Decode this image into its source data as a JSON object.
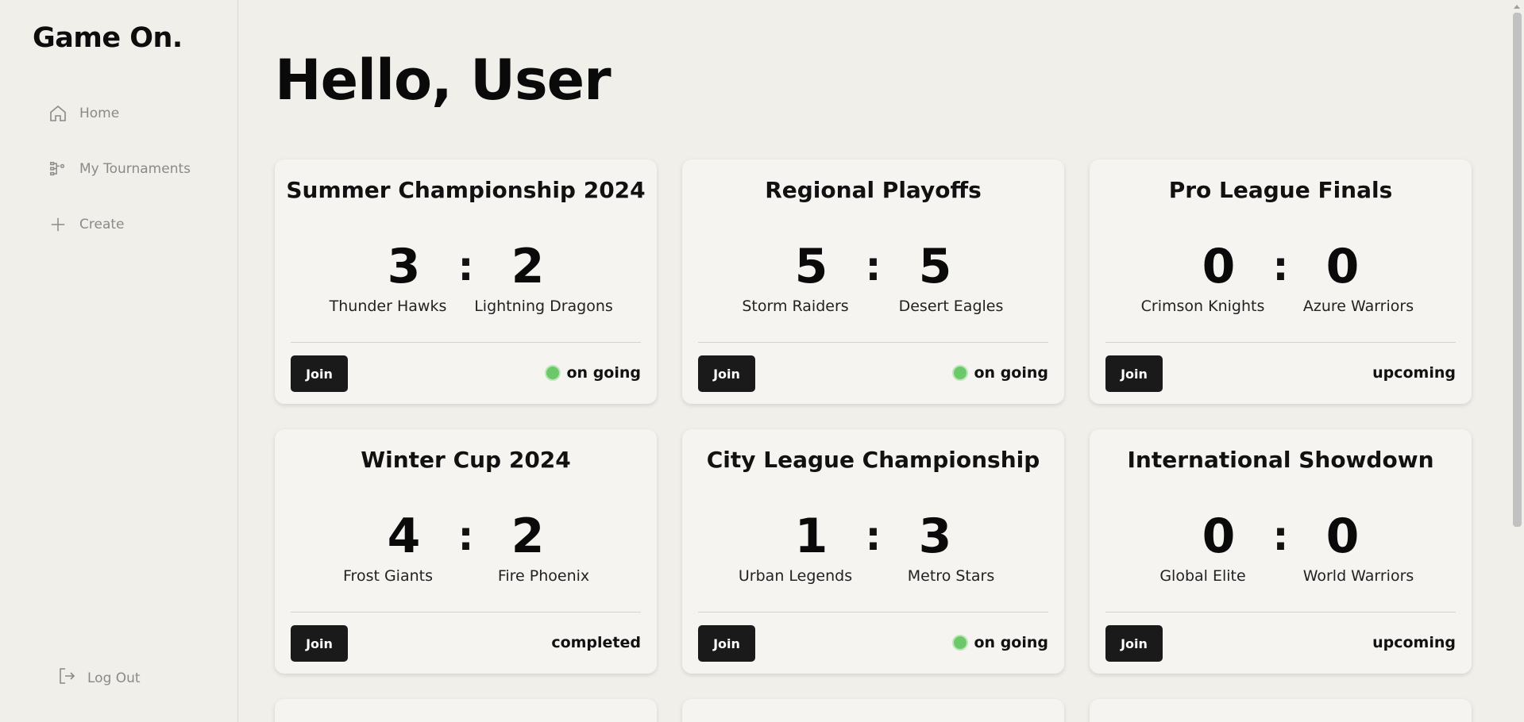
{
  "app": {
    "brand": "Game On."
  },
  "sidebar": {
    "items": [
      {
        "label": "Home",
        "icon": "home-icon"
      },
      {
        "label": "My Tournaments",
        "icon": "bracket-icon"
      },
      {
        "label": "Create",
        "icon": "plus-icon"
      }
    ],
    "logout": {
      "label": "Log Out",
      "icon": "logout-icon"
    }
  },
  "main": {
    "greeting": "Hello, User",
    "cards": [
      {
        "title": "Summer Championship 2024",
        "score_a": "3",
        "score_b": "2",
        "team_a": "Thunder Hawks",
        "team_b": "Lightning Dragons",
        "join": "Join",
        "status": "on going",
        "live": true
      },
      {
        "title": "Regional Playoffs",
        "score_a": "5",
        "score_b": "5",
        "team_a": "Storm Raiders",
        "team_b": "Desert Eagles",
        "join": "Join",
        "status": "on going",
        "live": true
      },
      {
        "title": "Pro League Finals",
        "score_a": "0",
        "score_b": "0",
        "team_a": "Crimson Knights",
        "team_b": "Azure Warriors",
        "join": "Join",
        "status": "upcoming",
        "live": false
      },
      {
        "title": "Winter Cup 2024",
        "score_a": "4",
        "score_b": "2",
        "team_a": "Frost Giants",
        "team_b": "Fire Phoenix",
        "join": "Join",
        "status": "completed",
        "live": false
      },
      {
        "title": "City League Championship",
        "score_a": "1",
        "score_b": "3",
        "team_a": "Urban Legends",
        "team_b": "Metro Stars",
        "join": "Join",
        "status": "on going",
        "live": true
      },
      {
        "title": "International Showdown",
        "score_a": "0",
        "score_b": "0",
        "team_a": "Global Elite",
        "team_b": "World Warriors",
        "join": "Join",
        "status": "upcoming",
        "live": false
      }
    ],
    "colon": ":"
  },
  "colors": {
    "live_dot": "#6cc96a",
    "button_bg": "#1a1a1a",
    "page_bg": "#f1efea"
  }
}
